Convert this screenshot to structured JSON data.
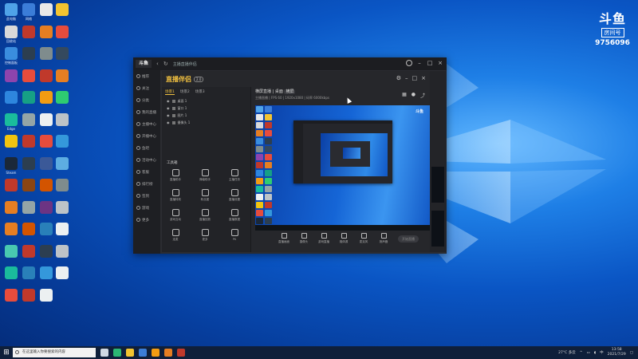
{
  "branding": {
    "logo_mark": "斗鱼",
    "room_label": "房间号",
    "room_number": "9756096"
  },
  "desktop_icons": [
    {
      "label": "此电脑",
      "color": "#4fa3e8"
    },
    {
      "label": "网络",
      "color": "#3b7dd8"
    },
    {
      "label": "",
      "color": "#e8e8e8"
    },
    {
      "label": "",
      "color": "#f4c430"
    },
    {
      "label": "回收站",
      "color": "#d9d9d9"
    },
    {
      "label": "",
      "color": "#c0392b"
    },
    {
      "label": "",
      "color": "#e67e22"
    },
    {
      "label": "",
      "color": "#e74c3c"
    },
    {
      "label": "控制面板",
      "color": "#3a8dde"
    },
    {
      "label": "",
      "color": "#2c3e50"
    },
    {
      "label": "",
      "color": "#7f8c8d"
    },
    {
      "label": "",
      "color": "#34495e"
    },
    {
      "label": "",
      "color": "#8e44ad"
    },
    {
      "label": "",
      "color": "#e74c3c"
    },
    {
      "label": "",
      "color": "#c0392b"
    },
    {
      "label": "",
      "color": "#e67e22"
    },
    {
      "label": "",
      "color": "#2e86de"
    },
    {
      "label": "",
      "color": "#16a085"
    },
    {
      "label": "",
      "color": "#f39c12"
    },
    {
      "label": "",
      "color": "#2ecc71"
    },
    {
      "label": "Edge",
      "color": "#1abc9c"
    },
    {
      "label": "",
      "color": "#95a5a6"
    },
    {
      "label": "",
      "color": "#ecf0f1"
    },
    {
      "label": "",
      "color": "#bdc3c7"
    },
    {
      "label": "",
      "color": "#f1c40f"
    },
    {
      "label": "",
      "color": "#c0392b"
    },
    {
      "label": "",
      "color": "#e74c3c"
    },
    {
      "label": "",
      "color": "#3498db"
    },
    {
      "label": "Steam",
      "color": "#1b2838"
    },
    {
      "label": "",
      "color": "#2c3e50"
    },
    {
      "label": "",
      "color": "#3b5998"
    },
    {
      "label": "",
      "color": "#5dade2"
    },
    {
      "label": "",
      "color": "#c0392b"
    },
    {
      "label": "",
      "color": "#8b4513"
    },
    {
      "label": "",
      "color": "#d35400"
    },
    {
      "label": "",
      "color": "#7f8c8d"
    },
    {
      "label": "",
      "color": "#e67e22"
    },
    {
      "label": "",
      "color": "#95a5a6"
    },
    {
      "label": "",
      "color": "#6c3483"
    },
    {
      "label": "",
      "color": "#bdc3c7"
    },
    {
      "label": "",
      "color": "#e67e22"
    },
    {
      "label": "",
      "color": "#d35400"
    },
    {
      "label": "",
      "color": "#2980b9"
    },
    {
      "label": "",
      "color": "#ecf0f1"
    },
    {
      "label": "",
      "color": "#48c9b0"
    },
    {
      "label": "",
      "color": "#c0392b"
    },
    {
      "label": "",
      "color": "#2c3e50"
    },
    {
      "label": "",
      "color": "#bdc3c7"
    },
    {
      "label": "",
      "color": "#1abc9c"
    },
    {
      "label": "",
      "color": "#2980b9"
    },
    {
      "label": "",
      "color": "#3498db"
    },
    {
      "label": "",
      "color": "#ecf0f1"
    },
    {
      "label": "",
      "color": "#e74c3c"
    },
    {
      "label": "",
      "color": "#c0392b"
    },
    {
      "label": "",
      "color": "#ecf0f1"
    }
  ],
  "window": {
    "logo": "斗鱼",
    "title": "主播直播伴侣"
  },
  "sidebar": [
    {
      "label": "推荐"
    },
    {
      "label": "关注"
    },
    {
      "label": "分类"
    },
    {
      "label": "我的直播"
    },
    {
      "label": "主播中心"
    },
    {
      "label": "开播中心"
    },
    {
      "label": "鱼吧"
    },
    {
      "label": "活动中心"
    },
    {
      "label": "客服"
    },
    {
      "label": "排行榜"
    },
    {
      "label": "签到"
    },
    {
      "label": "游戏"
    },
    {
      "label": "更多"
    }
  ],
  "broadcaster": {
    "brand": "直播伴侣",
    "tag": "2.0",
    "scene_tabs": [
      "场景1",
      "场景2",
      "场景3"
    ],
    "scene_rows": [
      {
        "label": "桌面 1"
      },
      {
        "label": "窗口 1"
      },
      {
        "label": "图片 1"
      },
      {
        "label": "摄像头 1"
      }
    ],
    "tools_title": "工具箱",
    "tools": [
      {
        "label": "直播助手"
      },
      {
        "label": "弹幕助手"
      },
      {
        "label": "主播任务"
      },
      {
        "label": "直播特效"
      },
      {
        "label": "粉丝团"
      },
      {
        "label": "直播设置"
      },
      {
        "label": "游戏互动"
      },
      {
        "label": "直播回放"
      },
      {
        "label": "直播数据"
      },
      {
        "label": "连麦"
      },
      {
        "label": "更多"
      },
      {
        "label": "PK"
      }
    ],
    "preview_title": "横屏直播 | 桌面",
    "preview_badge": "横屏",
    "preview_subtitle": "主播直播  |  FPS 60  |  1920x1080  |  码率 6000kbps",
    "bottom_buttons": [
      {
        "label": "直播画面"
      },
      {
        "label": "摄像头"
      },
      {
        "label": "游戏直播"
      },
      {
        "label": "媒体源"
      },
      {
        "label": "麦克风"
      },
      {
        "label": "扬声器"
      }
    ],
    "live_button": "开始直播"
  },
  "taskbar": {
    "search_placeholder": "在这里输入你要搜索的内容",
    "apps": [
      {
        "name": "task-view",
        "color": "#cfd8e3"
      },
      {
        "name": "edge",
        "color": "#2bb673"
      },
      {
        "name": "explorer",
        "color": "#f4c430"
      },
      {
        "name": "store",
        "color": "#3b7dd8"
      },
      {
        "name": "douyu",
        "color": "#f39c12"
      },
      {
        "name": "broadcaster",
        "color": "#e67e22"
      },
      {
        "name": "steam",
        "color": "#c0392b"
      }
    ],
    "weather": "27°C 多云",
    "ime": "中",
    "time": "13:58",
    "date": "2021/7/29"
  }
}
